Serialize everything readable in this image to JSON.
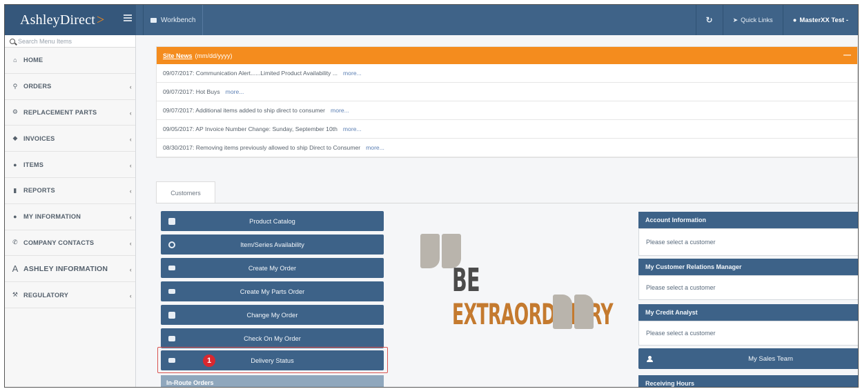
{
  "header": {
    "brand_main": "AshleyDirect",
    "brand_chevron": ">",
    "worklink_label": "Workbench",
    "refresh_icon": "refresh-icon",
    "quick_links": "Quick Links",
    "user": "MasterXX Test -"
  },
  "sidebar": {
    "search_placeholder": "Search Menu Items",
    "items": [
      {
        "label": "HOME",
        "icon": "home-icon"
      },
      {
        "label": "ORDERS",
        "icon": "cart-icon"
      },
      {
        "label": "REPLACEMENT PARTS",
        "icon": "cogs-icon"
      },
      {
        "label": "INVOICES",
        "icon": "tag-icon"
      },
      {
        "label": "ITEMS",
        "icon": "gear-icon"
      },
      {
        "label": "REPORTS",
        "icon": "file-icon"
      },
      {
        "label": "MY INFORMATION",
        "icon": "user-icon"
      },
      {
        "label": "COMPANY CONTACTS",
        "icon": "phone-icon"
      },
      {
        "label": "ASHLEY INFORMATION",
        "icon": "ashley-a-icon"
      },
      {
        "label": "REGULATORY",
        "icon": "gavel-icon"
      }
    ]
  },
  "news": {
    "title": "Site News",
    "date_format": "(mm/dd/yyyy)",
    "more_label": "more...",
    "rows": [
      {
        "text": "09/07/2017: Communication Alert......Limited Product Availability ..."
      },
      {
        "text": "09/07/2017: Hot Buys"
      },
      {
        "text": "09/07/2017: Additional items added to ship direct to consumer"
      },
      {
        "text": "09/05/2017: AP Invoice Number Change: Sunday, September 10th"
      },
      {
        "text": "08/30/2017: Removing items previously allowed to ship Direct to Consumer"
      }
    ]
  },
  "tabs": {
    "customers": "Customers"
  },
  "actions": [
    {
      "label": "Product Catalog",
      "icon": "book-icon"
    },
    {
      "label": "Item/Series Availability",
      "icon": "clock-icon"
    },
    {
      "label": "Create My Order",
      "icon": "cart-icon"
    },
    {
      "label": "Create My Parts Order",
      "icon": "cogs-icon"
    },
    {
      "label": "Change My Order",
      "icon": "edit-icon"
    },
    {
      "label": "Check On My Order",
      "icon": "check-square-icon"
    },
    {
      "label": "Delivery Status",
      "icon": "truck-icon"
    }
  ],
  "step_badge": "1",
  "in_route": "In-Route Orders",
  "slogan": {
    "line1": "BE",
    "line2": "EXTRAORDINARY"
  },
  "right_panels": {
    "account_title": "Account Information",
    "account_body": "Please select a customer",
    "crm_title": "My Customer Relations Manager",
    "crm_body": "Please select a customer",
    "credit_title": "My Credit Analyst",
    "credit_body": "Please select a customer",
    "sales_team": "My Sales Team",
    "receiving_hours": "Receiving Hours"
  },
  "colors": {
    "topbar": "#3f6388",
    "news_header": "#f48c1e",
    "button": "#3d6288",
    "highlight": "#d9534f",
    "slogan_accent": "#c47a2f"
  }
}
